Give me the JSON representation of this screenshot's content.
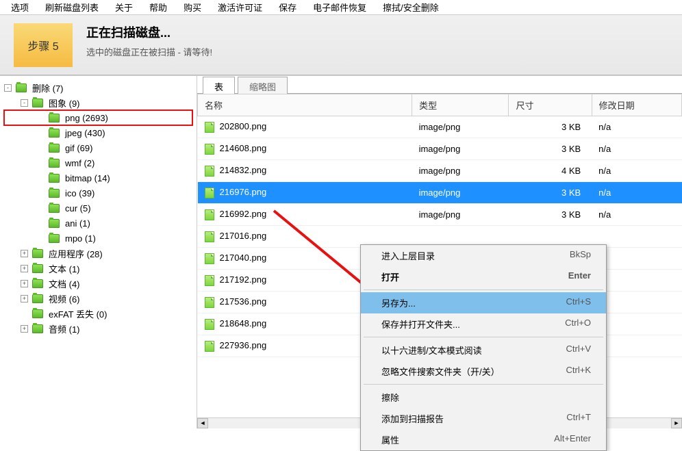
{
  "menu": [
    "选项",
    "刷新磁盘列表",
    "关于",
    "帮助",
    "购买",
    "激活许可证",
    "保存",
    "电子邮件恢复",
    "擦拭/安全删除"
  ],
  "banner": {
    "step": "步骤 5",
    "title": "正在扫描磁盘...",
    "subtitle": "选中的磁盘正在被扫描 - 请等待!"
  },
  "tree": [
    {
      "indent": 0,
      "exp": "-",
      "label": "删除 (7)"
    },
    {
      "indent": 1,
      "exp": "-",
      "label": "图象 (9)"
    },
    {
      "indent": 2,
      "exp": "",
      "label": "png (2693)",
      "highlight": true
    },
    {
      "indent": 2,
      "exp": "",
      "label": "jpeg (430)"
    },
    {
      "indent": 2,
      "exp": "",
      "label": "gif (69)"
    },
    {
      "indent": 2,
      "exp": "",
      "label": "wmf (2)"
    },
    {
      "indent": 2,
      "exp": "",
      "label": "bitmap (14)"
    },
    {
      "indent": 2,
      "exp": "",
      "label": "ico (39)"
    },
    {
      "indent": 2,
      "exp": "",
      "label": "cur (5)"
    },
    {
      "indent": 2,
      "exp": "",
      "label": "ani (1)"
    },
    {
      "indent": 2,
      "exp": "",
      "label": "mpo (1)"
    },
    {
      "indent": 1,
      "exp": "+",
      "label": "应用程序 (28)"
    },
    {
      "indent": 1,
      "exp": "+",
      "label": "文本 (1)"
    },
    {
      "indent": 1,
      "exp": "+",
      "label": "文档 (4)"
    },
    {
      "indent": 1,
      "exp": "+",
      "label": "视频 (6)"
    },
    {
      "indent": 1,
      "exp": "",
      "label": "exFAT 丢失 (0)"
    },
    {
      "indent": 1,
      "exp": "+",
      "label": "音频 (1)"
    }
  ],
  "tabs": {
    "active": "表",
    "inactive": "缩略图"
  },
  "columns": [
    "名称",
    "类型",
    "尺寸",
    "修改日期"
  ],
  "rows": [
    {
      "name": "202800.png",
      "type": "image/png",
      "size": "3 KB",
      "date": "n/a"
    },
    {
      "name": "214608.png",
      "type": "image/png",
      "size": "3 KB",
      "date": "n/a"
    },
    {
      "name": "214832.png",
      "type": "image/png",
      "size": "4 KB",
      "date": "n/a"
    },
    {
      "name": "216976.png",
      "type": "image/png",
      "size": "3 KB",
      "date": "n/a",
      "selected": true
    },
    {
      "name": "216992.png",
      "type": "image/png",
      "size": "3 KB",
      "date": "n/a"
    },
    {
      "name": "217016.png",
      "type": "",
      "size": "",
      "date": ""
    },
    {
      "name": "217040.png",
      "type": "",
      "size": "",
      "date": ""
    },
    {
      "name": "217192.png",
      "type": "",
      "size": "",
      "date": ""
    },
    {
      "name": "217536.png",
      "type": "",
      "size": "",
      "date": ""
    },
    {
      "name": "218648.png",
      "type": "",
      "size": "",
      "date": ""
    },
    {
      "name": "227936.png",
      "type": "",
      "size": "",
      "date": ""
    }
  ],
  "context_menu": [
    {
      "label": "进入上层目录",
      "shortcut": "BkSp"
    },
    {
      "label": "打开",
      "shortcut": "Enter",
      "bold": true
    },
    {
      "sep": true
    },
    {
      "label": "另存为...",
      "shortcut": "Ctrl+S",
      "hl": true
    },
    {
      "label": "保存并打开文件夹...",
      "shortcut": "Ctrl+O"
    },
    {
      "sep": true
    },
    {
      "label": "以十六进制/文本模式阅读",
      "shortcut": "Ctrl+V"
    },
    {
      "label": "忽略文件搜索文件夹（开/关）",
      "shortcut": "Ctrl+K"
    },
    {
      "sep": true
    },
    {
      "label": "擦除",
      "shortcut": ""
    },
    {
      "label": "添加到扫描报告",
      "shortcut": "Ctrl+T"
    },
    {
      "label": "属性",
      "shortcut": "Alt+Enter"
    }
  ],
  "highlight_color": "#e81010"
}
